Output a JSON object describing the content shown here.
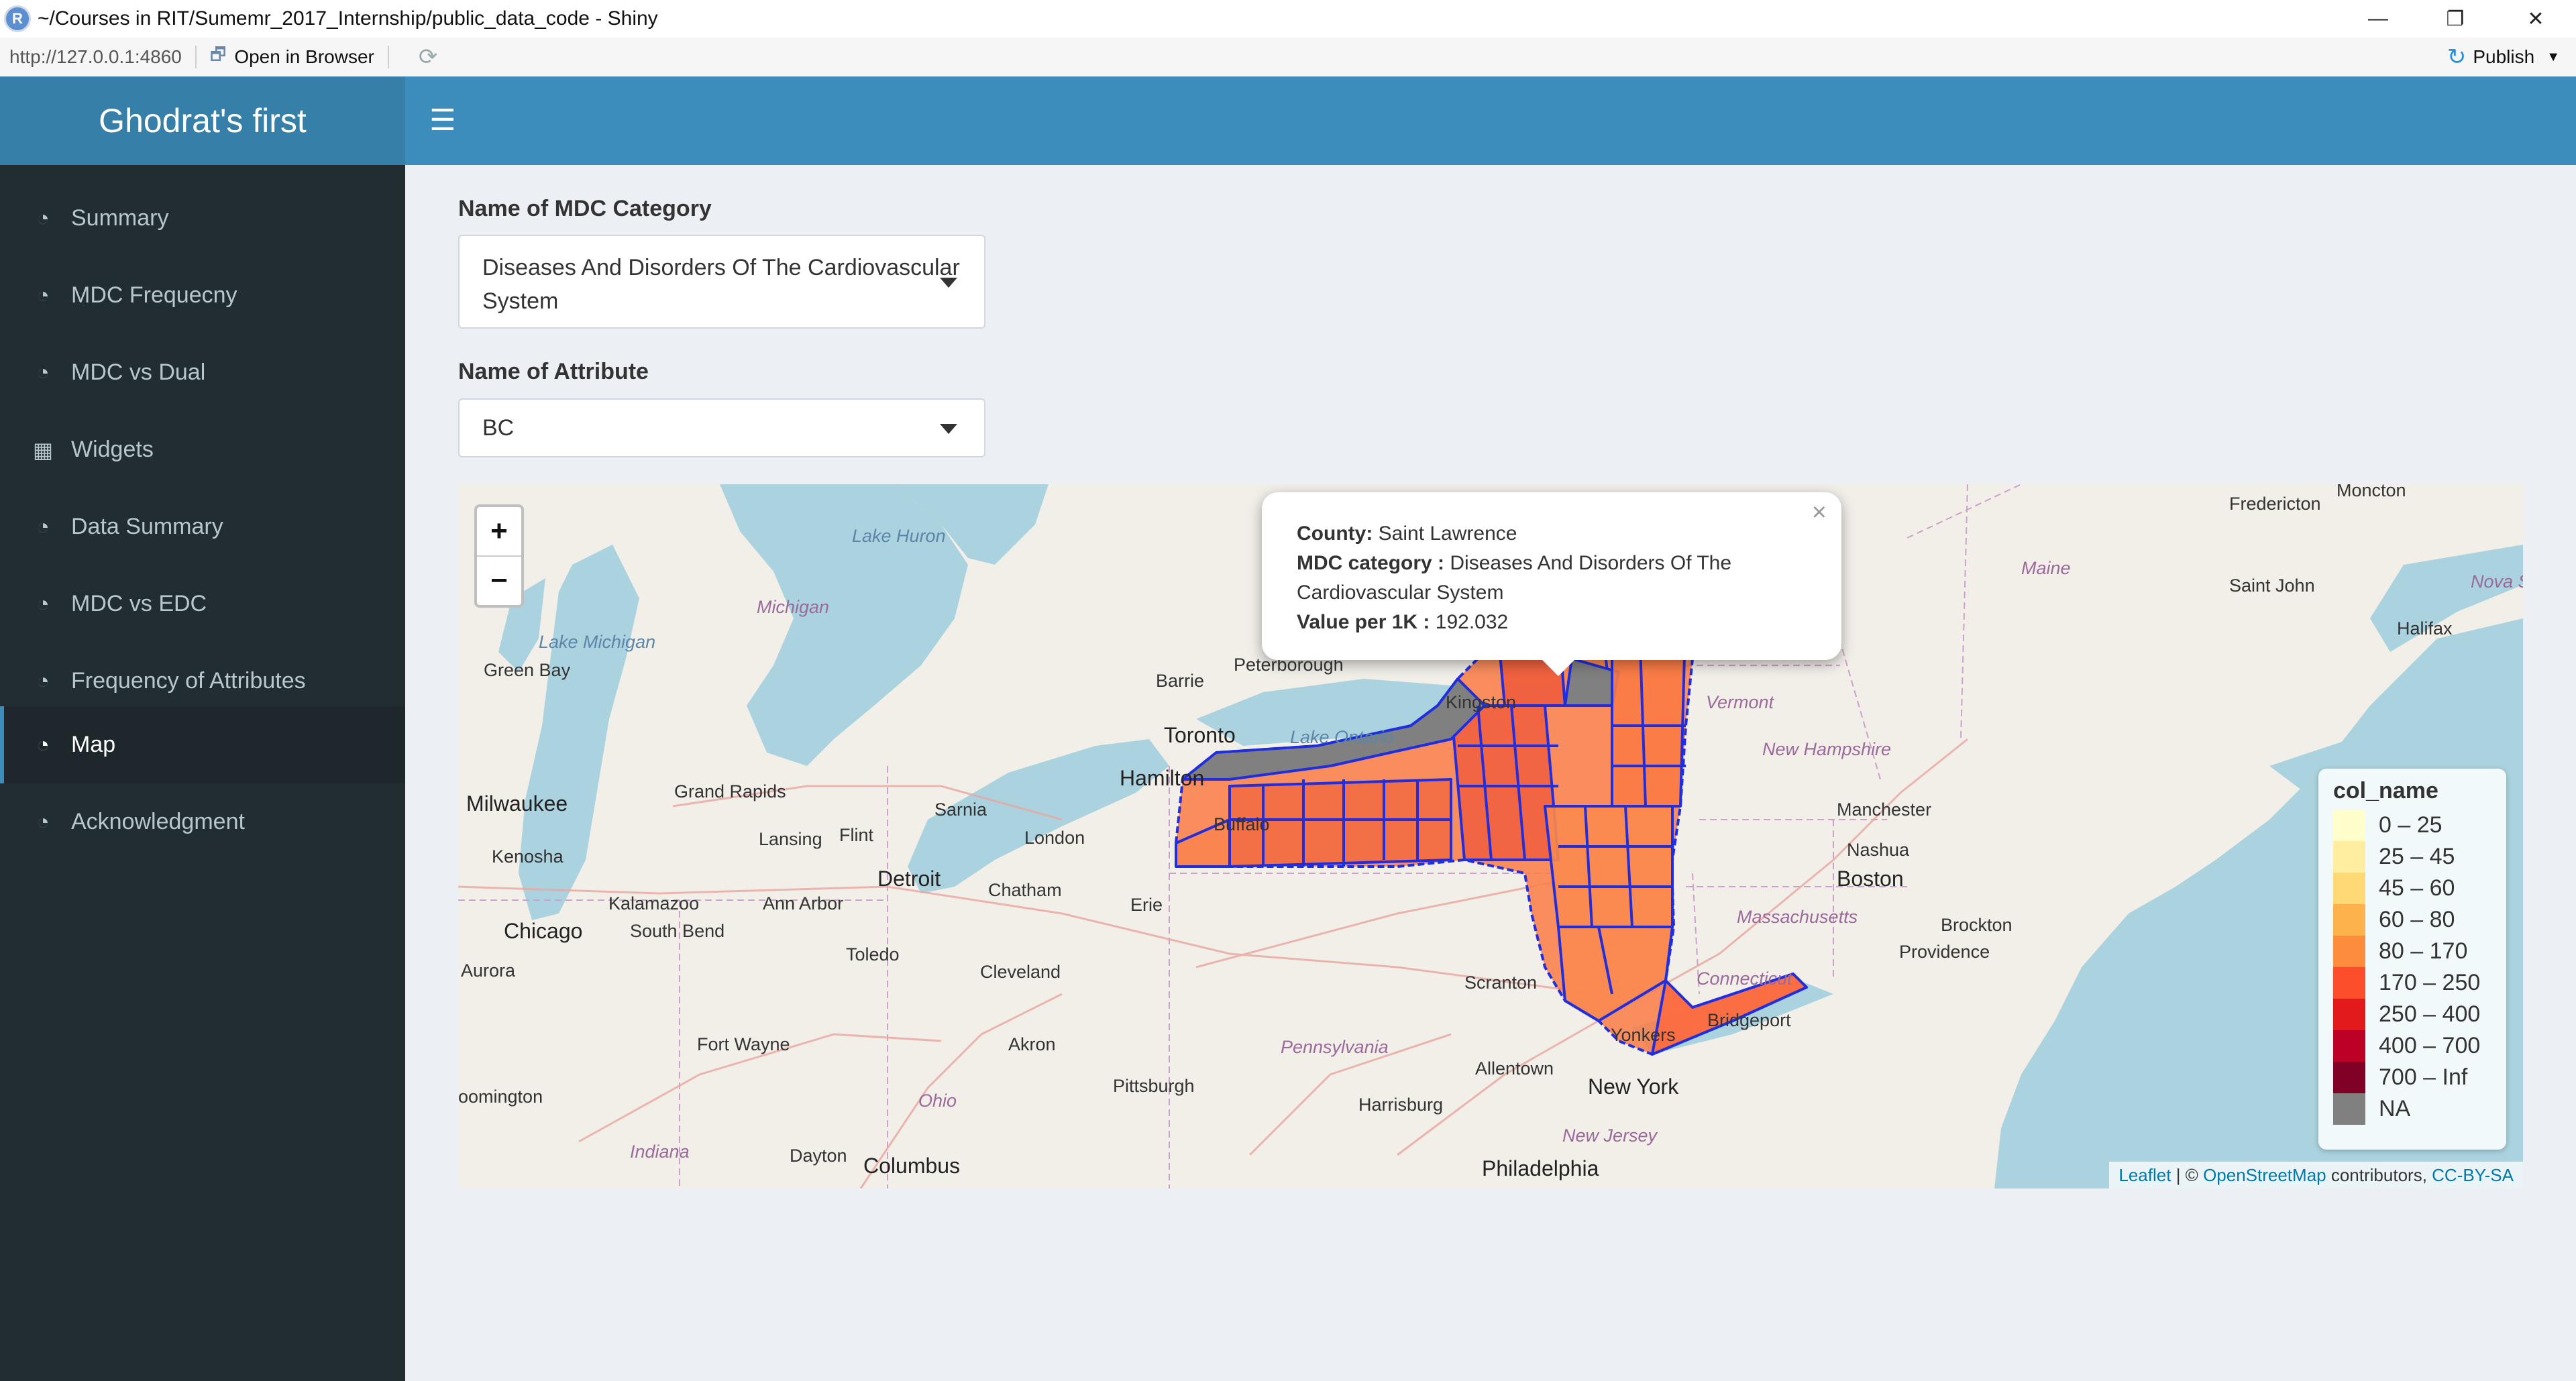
{
  "window": {
    "title": "~/Courses in RIT/Sumemr_2017_Internship/public_data_code - Shiny",
    "logo_letter": "R",
    "minimize_glyph": "—",
    "maximize_glyph": "❐",
    "close_glyph": "✕"
  },
  "addressbar": {
    "url": "http://127.0.0.1:4860",
    "open_browser_label": "Open in Browser",
    "open_browser_icon": "open-browser-icon",
    "refresh_icon": "refresh-icon",
    "publish_label": "Publish"
  },
  "header": {
    "brand": "Ghodrat's first",
    "toggle_icon": "hamburger-icon"
  },
  "sidebar": {
    "items": [
      {
        "label": "Summary",
        "icon": "dashboard-icon",
        "active": false
      },
      {
        "label": "MDC Frequecny",
        "icon": "dashboard-icon",
        "active": false
      },
      {
        "label": "MDC vs Dual",
        "icon": "dashboard-icon",
        "active": false
      },
      {
        "label": "Widgets",
        "icon": "th-icon",
        "active": false
      },
      {
        "label": "Data Summary",
        "icon": "dashboard-icon",
        "active": false
      },
      {
        "label": "MDC vs EDC",
        "icon": "dashboard-icon",
        "active": false
      },
      {
        "label": "Frequency of Attributes",
        "icon": "dashboard-icon",
        "active": false
      },
      {
        "label": "Map",
        "icon": "dashboard-icon",
        "active": true
      },
      {
        "label": "Acknowledgment",
        "icon": "dashboard-icon",
        "active": false
      }
    ]
  },
  "inputs": {
    "mdc_label": "Name of MDC Category",
    "mdc_value_line1": "Diseases And Disorders Of The Cardiovascular",
    "mdc_value_line2": "System",
    "attribute_label": "Name of Attribute",
    "attribute_value": "BC"
  },
  "map": {
    "zoom_in": "+",
    "zoom_out": "−",
    "popup": {
      "county_key": "County:",
      "county_value": "Saint Lawrence",
      "mdc_key": "MDC category :",
      "mdc_value_line1": "Diseases And Disorders Of The",
      "mdc_value_line2": "Cardiovascular System",
      "value_key": "Value per 1K :",
      "value_value": "192.032",
      "close": "×"
    },
    "legend": {
      "title": "col_name",
      "entries": [
        {
          "label": "0 – 25",
          "color": "#ffffcc"
        },
        {
          "label": "25 – 45",
          "color": "#ffeda0"
        },
        {
          "label": "45 – 60",
          "color": "#fed976"
        },
        {
          "label": "60 – 80",
          "color": "#feb24c"
        },
        {
          "label": "80 – 170",
          "color": "#fd8d3c"
        },
        {
          "label": "170 – 250",
          "color": "#fc4e2a"
        },
        {
          "label": "250 – 400",
          "color": "#e31a1c"
        },
        {
          "label": "400 – 700",
          "color": "#bd0026"
        },
        {
          "label": "700 – Inf",
          "color": "#800026"
        },
        {
          "label": "NA",
          "color": "#808080"
        }
      ]
    },
    "attribution": {
      "leaflet": "Leaflet",
      "sep": " | © ",
      "osm": "OpenStreetMap",
      "contrib": " contributors, ",
      "license": "CC-BY-SA"
    },
    "places": [
      "Moncton",
      "Fredericton",
      "Maine",
      "Saint John",
      "Nova S",
      "Halifax",
      "Lake Huron",
      "Michigan",
      "Lake Michigan",
      "Green Bay",
      "Barrie",
      "Peterborough",
      "Kingston",
      "Toronto",
      "Lake Ontario",
      "Hamilton",
      "Vermont",
      "New Hampshire",
      "Milwaukee",
      "Grand Rapids",
      "Sarnia",
      "Lansing",
      "Flint",
      "London",
      "Manchester",
      "Nashua",
      "Kenosha",
      "Detroit",
      "Boston",
      "Kalamazoo",
      "Ann Arbor",
      "Chatham",
      "Erie",
      "Massachusetts",
      "Chicago",
      "South Bend",
      "Toledo",
      "Brockton",
      "Providence",
      "Aurora",
      "Cleveland",
      "Scranton",
      "Connecticut",
      "Fort Wayne",
      "Akron",
      "Pennsylvania",
      "Bridgeport",
      "Allentown",
      "Yonkers",
      "New York",
      "Ohio",
      "Pittsburgh",
      "Harrisburg",
      "oomington",
      "New Jersey",
      "Indiana",
      "Dayton",
      "Columbus",
      "Philadelphia",
      "Buffalo"
    ]
  }
}
